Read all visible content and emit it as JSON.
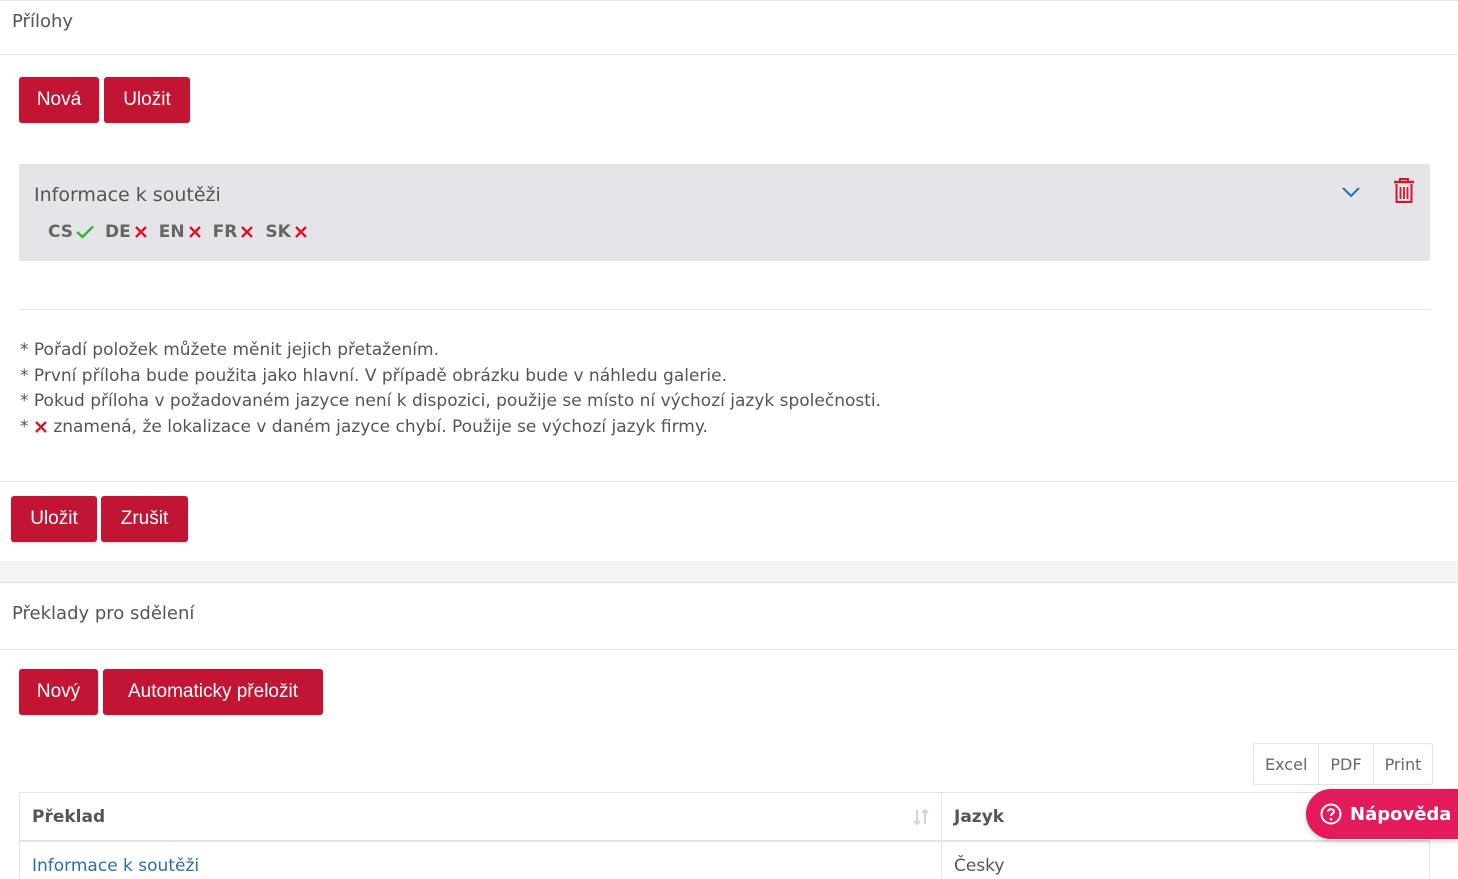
{
  "attachments": {
    "title": "Přílohy",
    "btn_new": "Nová",
    "btn_save": "Uložit",
    "item": {
      "title": "Informace k soutěži",
      "languages": [
        {
          "code": "CS",
          "status": "ok"
        },
        {
          "code": "DE",
          "status": "missing"
        },
        {
          "code": "EN",
          "status": "missing"
        },
        {
          "code": "FR",
          "status": "missing"
        },
        {
          "code": "SK",
          "status": "missing"
        }
      ]
    },
    "notes": {
      "n1": "* Pořadí položek můžete měnit jejich přetažením.",
      "n2": "* První příloha bude použita jako hlavní. V případě obrázku bude v náhledu galerie.",
      "n3": "* Pokud příloha v požadovaném jazyce není k dispozici, použije se místo ní výchozí jazyk společnosti.",
      "n4_prefix": "*",
      "n4_text": "znamená, že lokalizace v daném jazyce chybí. Použije se výchozí jazyk firmy."
    },
    "footer_save": "Uložit",
    "footer_cancel": "Zrušit"
  },
  "translations": {
    "title": "Překlady pro sdělení",
    "btn_new": "Nový",
    "btn_auto": "Automaticky přeložit",
    "export": {
      "excel": "Excel",
      "pdf": "PDF",
      "print": "Print"
    },
    "columns": {
      "translation": "Překlad",
      "language": "Jazyk"
    },
    "rows": [
      {
        "translation": "Informace k soutěži",
        "language": "Česky"
      }
    ]
  },
  "help_button": "Nápověda",
  "colors": {
    "primary": "#c21534",
    "ok": "#2eb82e",
    "missing": "#d6162c",
    "link": "#2a6db5",
    "help": "#e31a5c"
  }
}
